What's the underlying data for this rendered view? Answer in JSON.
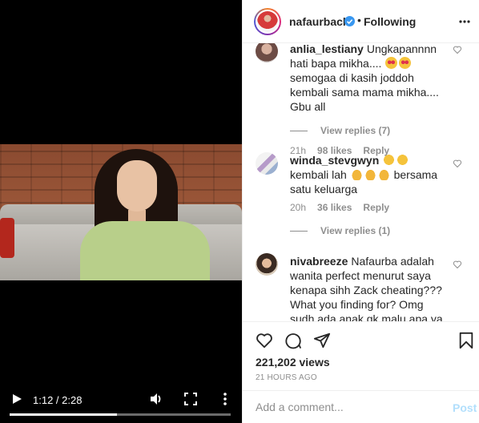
{
  "video": {
    "current_time": "1:12",
    "duration": "2:28",
    "time_label": "1:12 / 2:28",
    "progress": 0.486
  },
  "header": {
    "username": "nafaurbach",
    "separator": "•",
    "follow_status": "Following"
  },
  "comments": [
    {
      "user": "anlia_lestiany",
      "text_parts": [
        "Ungkapannnn hati bapa mikha.... ",
        " semogaa di kasih joddoh kembali sama mama mikha.... Gbu all"
      ],
      "time": "21h",
      "likes": "98 likes",
      "reply_label": "Reply",
      "view_replies": "View replies (7)"
    },
    {
      "user": "winda_stevgwyn",
      "text_parts": [
        " kembali lah ",
        " bersama satu keluarga"
      ],
      "time": "20h",
      "likes": "36 likes",
      "reply_label": "Reply",
      "view_replies": "View replies (1)"
    },
    {
      "user": "nivabreeze",
      "text": "Nafaurba adalah wanita perfect menurut saya kenapa sihh Zack cheating??? What you finding for? Omg sudh ada anak gk malu apa ya uda"
    }
  ],
  "stats": {
    "views": "221,202 views",
    "posted": "21 HOURS AGO"
  },
  "add_comment": {
    "placeholder": "Add a comment...",
    "post_label": "Post"
  },
  "colors": {
    "verified": "#3897f0",
    "post_disabled": "#b2dffc",
    "muted_text": "#8e8e8e"
  },
  "icons": [
    "play-icon",
    "volume-icon",
    "fullscreen-icon",
    "more-icon",
    "verified-icon",
    "heart-icon",
    "comment-icon",
    "share-icon",
    "bookmark-icon"
  ]
}
